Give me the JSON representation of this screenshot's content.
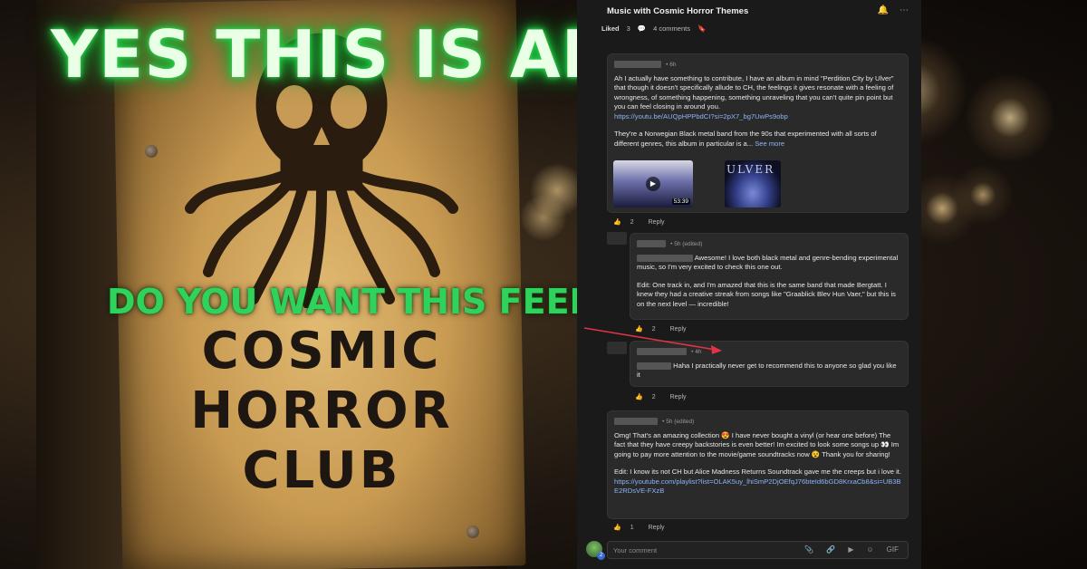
{
  "ad": {
    "headline": "YES THIS IS AN AD",
    "subline": "DO YOU WANT THIS FEELING?",
    "poster_lines": [
      "COSMIC",
      "HORROR",
      "CLUB"
    ]
  },
  "post": {
    "title": "Music with Cosmic Horror Themes",
    "liked_label": "Liked",
    "like_count": "3",
    "comments_label": "4 comments"
  },
  "comments": [
    {
      "time": "• 6h",
      "paragraphs": [
        "Ah I actually have something to contribute, I have an album in mind \"Perdition City by Ulver\" that though it doesn't specifically allude to CH, the feelings it gives resonate with a feeling of wrongness, of something happening, something unraveling that you can't quite pin point but you can feel closing in around you.",
        "They're a Norwegian Black metal band from the 90s that experimented with all sorts of different genres, this album in particular is a..."
      ],
      "link": "https://youtu.be/AUQpHPPbdCI?si=2pX7_bg7UwPs9obp",
      "see_more": "See more",
      "video_duration": "53:39",
      "album_art_text": "ULVER",
      "likes": "2",
      "reply_label": "Reply"
    },
    {
      "time": "• 5h (edited)",
      "paragraphs": [
        "Awesome! I love both black metal and genre-bending experimental music, so I'm very excited to check this one out.",
        "Edit: One track in, and I'm amazed that this is the same band that made Bergtatt. I knew they had a creative streak from songs like \"Graablick Blev Hun Vaer,\" but this is on the next level — incredible!"
      ],
      "likes": "2",
      "reply_label": "Reply"
    },
    {
      "time": "• 4h",
      "paragraphs": [
        "Haha I practically never get to recommend this to anyone so glad you like it"
      ],
      "likes": "2",
      "reply_label": "Reply"
    },
    {
      "time": "• 5h (edited)",
      "paragraphs": [
        "Omg! That's an amazing collection 😍 I have never bought a vinyl (or hear one before) The fact that they have creepy backstories is even better! Im excited to look some songs up 👀 Im going to pay more attention to the movie/game soundtracks now 😵 Thank you for sharing!",
        "Edit: I know its not CH but Alice Madness Returns Soundtrack gave me the creeps but i love it."
      ],
      "link": "https://youtube.com/playlist?list=OLAK5uy_lhiSmP2DjOEfqJ76bteId6bGD8KrxaCb8&si=UB3BE2RDsVE-FXzB",
      "likes": "1",
      "reply_label": "Reply"
    }
  ],
  "composer": {
    "placeholder": "Your comment",
    "gif_label": "GIF",
    "badge_count": "2"
  }
}
